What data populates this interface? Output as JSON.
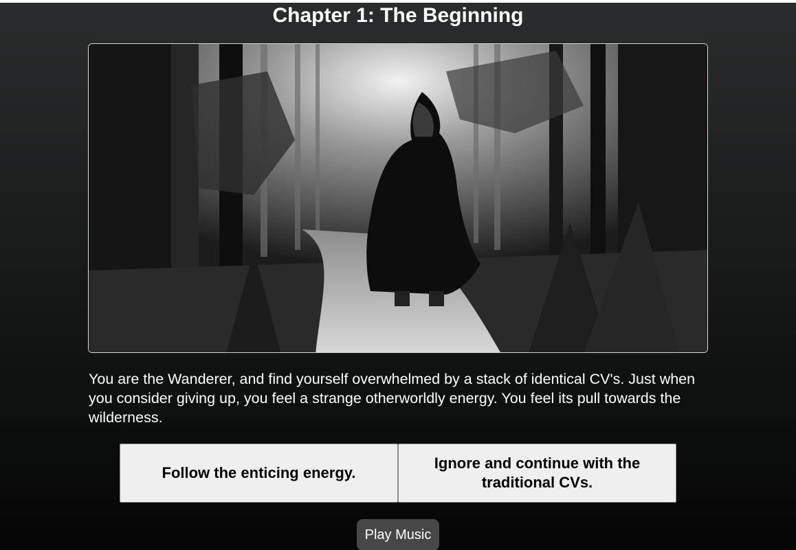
{
  "chapter": {
    "title": "Chapter 1: The Beginning"
  },
  "scene": {
    "image_name": "hooded-wanderer-forest-path-illustration"
  },
  "story": {
    "text": "You are the Wanderer, and find yourself overwhelmed by a stack of identical CV's. Just when you consider giving up, you feel a strange otherworldly energy. You feel its pull towards the wilderness."
  },
  "choices": [
    {
      "label": "Follow the enticing energy."
    },
    {
      "label": "Ignore and continue with the traditional CVs."
    }
  ],
  "music": {
    "label": "Play Music"
  }
}
